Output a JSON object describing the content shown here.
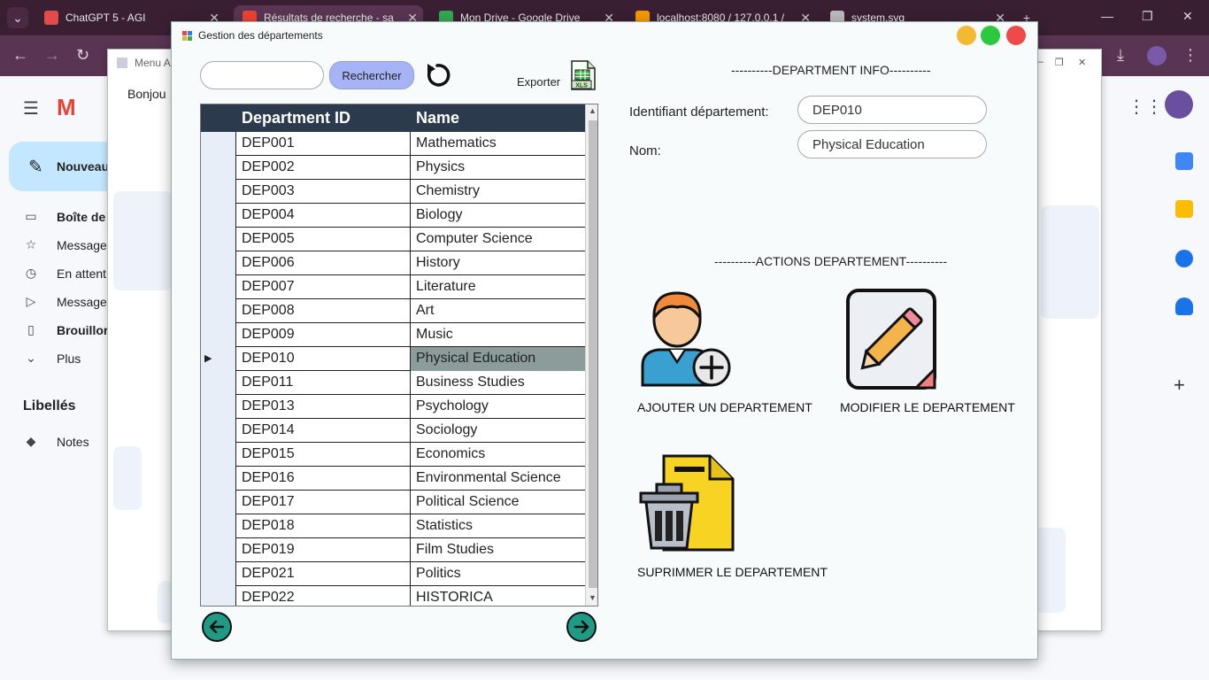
{
  "browser": {
    "tabs": [
      {
        "label": "ChatGPT 5 - AGI",
        "color": "#e34b4b"
      },
      {
        "label": "Résultats de recherche - sa",
        "color": "#ea4335"
      },
      {
        "label": "Mon Drive - Google Drive",
        "color": "#34a853"
      },
      {
        "label": "localhost:8080 / 127.0.0.1 /",
        "color": "#f29900"
      },
      {
        "label": "system.svg",
        "color": "#bbbbbb"
      }
    ]
  },
  "gmail": {
    "compose": "Nouveau",
    "nav": [
      {
        "icon": "inbox-icon",
        "glyph": "▭",
        "label": "Boîte de",
        "bold": true
      },
      {
        "icon": "star-icon",
        "glyph": "☆",
        "label": "Message",
        "bold": false
      },
      {
        "icon": "clock-icon",
        "glyph": "◷",
        "label": "En attent",
        "bold": false
      },
      {
        "icon": "send-icon",
        "glyph": "▷",
        "label": "Message",
        "bold": false
      },
      {
        "icon": "draft-icon",
        "glyph": "▯",
        "label": "Brouillor",
        "bold": true
      },
      {
        "icon": "chevron-down-icon",
        "glyph": "⌄",
        "label": "Plus",
        "bold": false
      }
    ],
    "labels_title": "Libellés",
    "label_notes": "Notes"
  },
  "menu_window": {
    "title": "Menu A",
    "greeting": "Bonjou"
  },
  "dialog": {
    "title": "Gestion des départements",
    "search_placeholder": "",
    "search_button": "Rechercher",
    "export_label": "Exporter",
    "xls_label": "XLS",
    "grid": {
      "headers": [
        "Department ID",
        "Name"
      ],
      "rows": [
        [
          "DEP001",
          "Mathematics"
        ],
        [
          "DEP002",
          "Physics"
        ],
        [
          "DEP003",
          "Chemistry"
        ],
        [
          "DEP004",
          "Biology"
        ],
        [
          "DEP005",
          "Computer Science"
        ],
        [
          "DEP006",
          "History"
        ],
        [
          "DEP007",
          "Literature"
        ],
        [
          "DEP008",
          "Art"
        ],
        [
          "DEP009",
          "Music"
        ],
        [
          "DEP010",
          "Physical Education"
        ],
        [
          "DEP011",
          "Business Studies"
        ],
        [
          "DEP013",
          "Psychology"
        ],
        [
          "DEP014",
          "Sociology"
        ],
        [
          "DEP015",
          "Economics"
        ],
        [
          "DEP016",
          "Environmental Science"
        ],
        [
          "DEP017",
          "Political Science"
        ],
        [
          "DEP018",
          "Statistics"
        ],
        [
          "DEP019",
          "Film Studies"
        ],
        [
          "DEP021",
          "Politics"
        ],
        [
          "DEP022",
          "HISTORICA"
        ]
      ],
      "selected_index": 9
    },
    "info": {
      "section_title": "----------DEPARTMENT INFO----------",
      "id_label": "Identifiant département:",
      "id_value": "DEP010",
      "name_label": "Nom:",
      "name_value": "Physical Education"
    },
    "actions": {
      "section_title": "----------ACTIONS DEPARTEMENT----------",
      "add_label": "AJOUTER UN DEPARTEMENT",
      "edit_label": "MODIFIER LE DEPARTEMENT",
      "delete_label": "SUPRIMMER LE DEPARTEMENT"
    },
    "colors": {
      "header_bg": "#2b3a4d",
      "selected_row": "#8b9c9a",
      "search_button": "#a6b4f5",
      "pager": "#1f9a84",
      "dot_yellow": "#f5b931",
      "dot_green": "#2bc840",
      "dot_red": "#ee4a4a"
    }
  }
}
